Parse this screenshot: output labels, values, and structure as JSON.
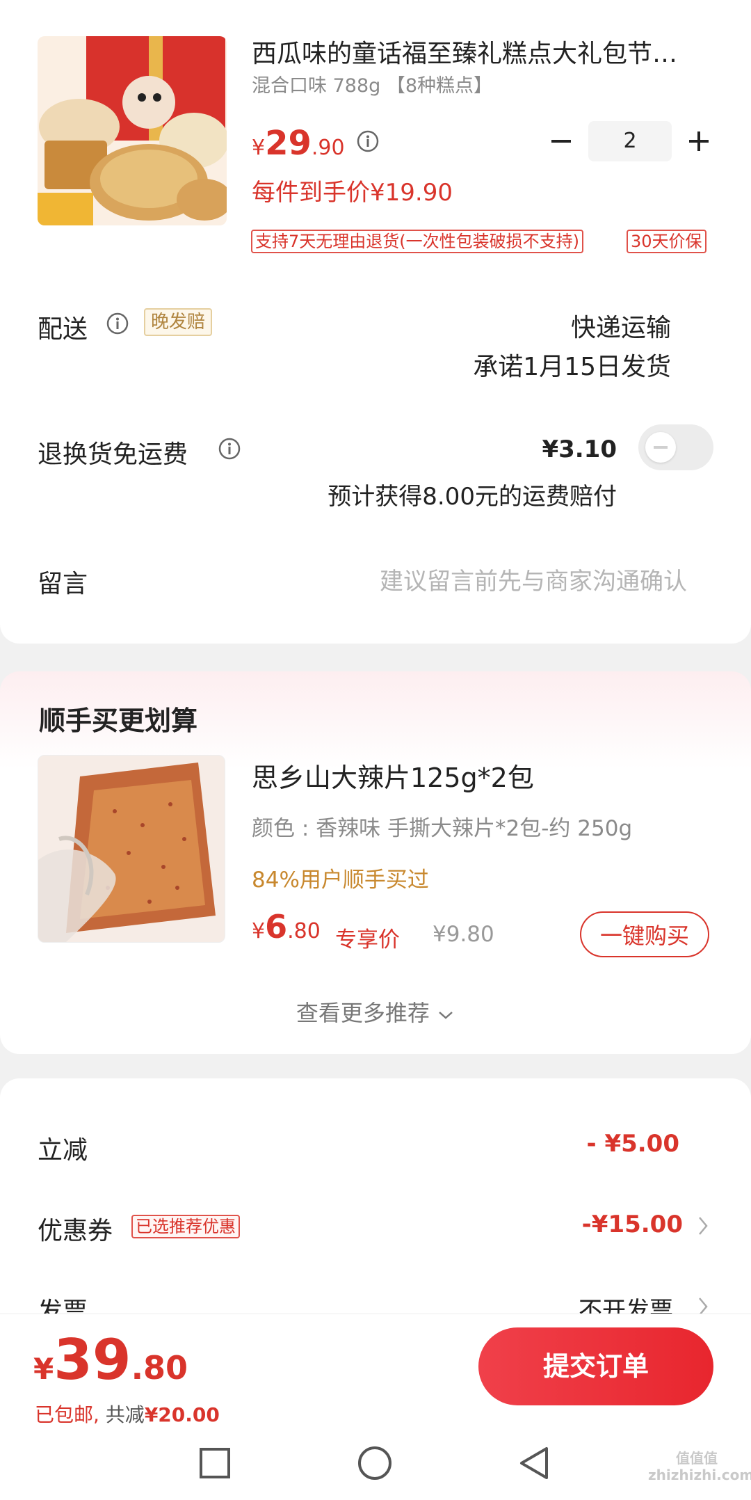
{
  "product": {
    "title": "西瓜味的童话福至臻礼糕点大礼包节…",
    "spec": "混合口味 788g 【8种糕点】",
    "price_symbol": "¥",
    "price_int": "29",
    "price_dec": ".90",
    "quantity": "2",
    "per_item_price": "每件到手价¥19.90",
    "tags": [
      "支持7天无理由退货(一次性包装破损不支持)",
      "30天价保"
    ]
  },
  "delivery": {
    "label": "配送",
    "badge": "晚发赔",
    "method": "快递运输",
    "promise": "承诺1月15日发货"
  },
  "return_shipping": {
    "label": "退换货免运费",
    "price": "¥3.10",
    "note": "预计获得8.00元的运费赔付"
  },
  "message": {
    "label": "留言",
    "placeholder": "建议留言前先与商家沟通确认"
  },
  "recommend": {
    "title": "顺手买更划算",
    "item_title": "思乡山大辣片125g*2包",
    "item_spec": "颜色 : 香辣味 手撕大辣片*2包-约 250g",
    "item_social": "84%用户顺手买过",
    "price_symbol": "¥",
    "price_int": "6",
    "price_dec": ".80",
    "exclusive_label": "专享价",
    "original_price": "¥9.80",
    "buy_button": "一键购买",
    "more_label": "查看更多推荐"
  },
  "discounts": {
    "instant_label": "立减",
    "instant_value": "- ¥5.00",
    "coupon_label": "优惠券",
    "coupon_badge": "已选推荐优惠",
    "coupon_value": "-¥15.00",
    "invoice_label": "发票",
    "invoice_value": "不开发票"
  },
  "footer": {
    "total_symbol": "¥",
    "total_int": "39",
    "total_dec": ".80",
    "shipping_note": "已包邮,",
    "saved_label": " 共减",
    "saved_value": "¥20.00",
    "submit_button": "提交订单"
  },
  "watermark": "值值值 zhizhizhi.com",
  "colors": {
    "accent": "#d9342b",
    "orange": "#c8882e",
    "button_gradient_start": "#f0404a",
    "button_gradient_end": "#e8262e"
  }
}
